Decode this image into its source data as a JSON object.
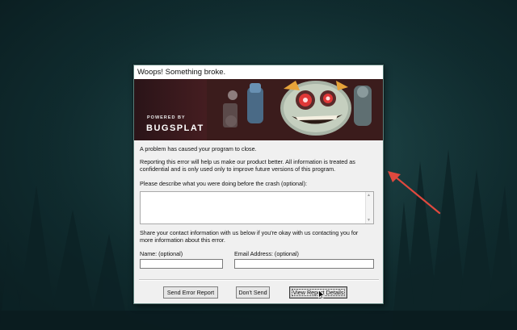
{
  "dialog": {
    "title": "Woops! Something broke.",
    "banner": {
      "powered_by": "POWERED BY",
      "brand": "BUGSPLAT"
    },
    "message": "A problem has caused your program to close.",
    "reporting_info_line1": "Reporting this error will help us make our product better. All information is treated as",
    "reporting_info_line2": "confidential and is only used only to improve future versions of this program.",
    "describe_label": "Please describe what you were doing before the crash (optional):",
    "describe_value": "",
    "contact_info_line1": "Share your contact information with us below if you're okay with us contacting you for",
    "contact_info_line2": "more information about this error.",
    "name_label": "Name: (optional)",
    "name_value": "",
    "email_label": "Email Address: (optional)",
    "email_value": "",
    "buttons": {
      "send": "Send Error Report",
      "dont_send": "Don't Send",
      "view_details": "View Report Details"
    }
  },
  "colors": {
    "annotation_arrow": "#e0493e",
    "dialog_bg": "#f0f0f0"
  }
}
